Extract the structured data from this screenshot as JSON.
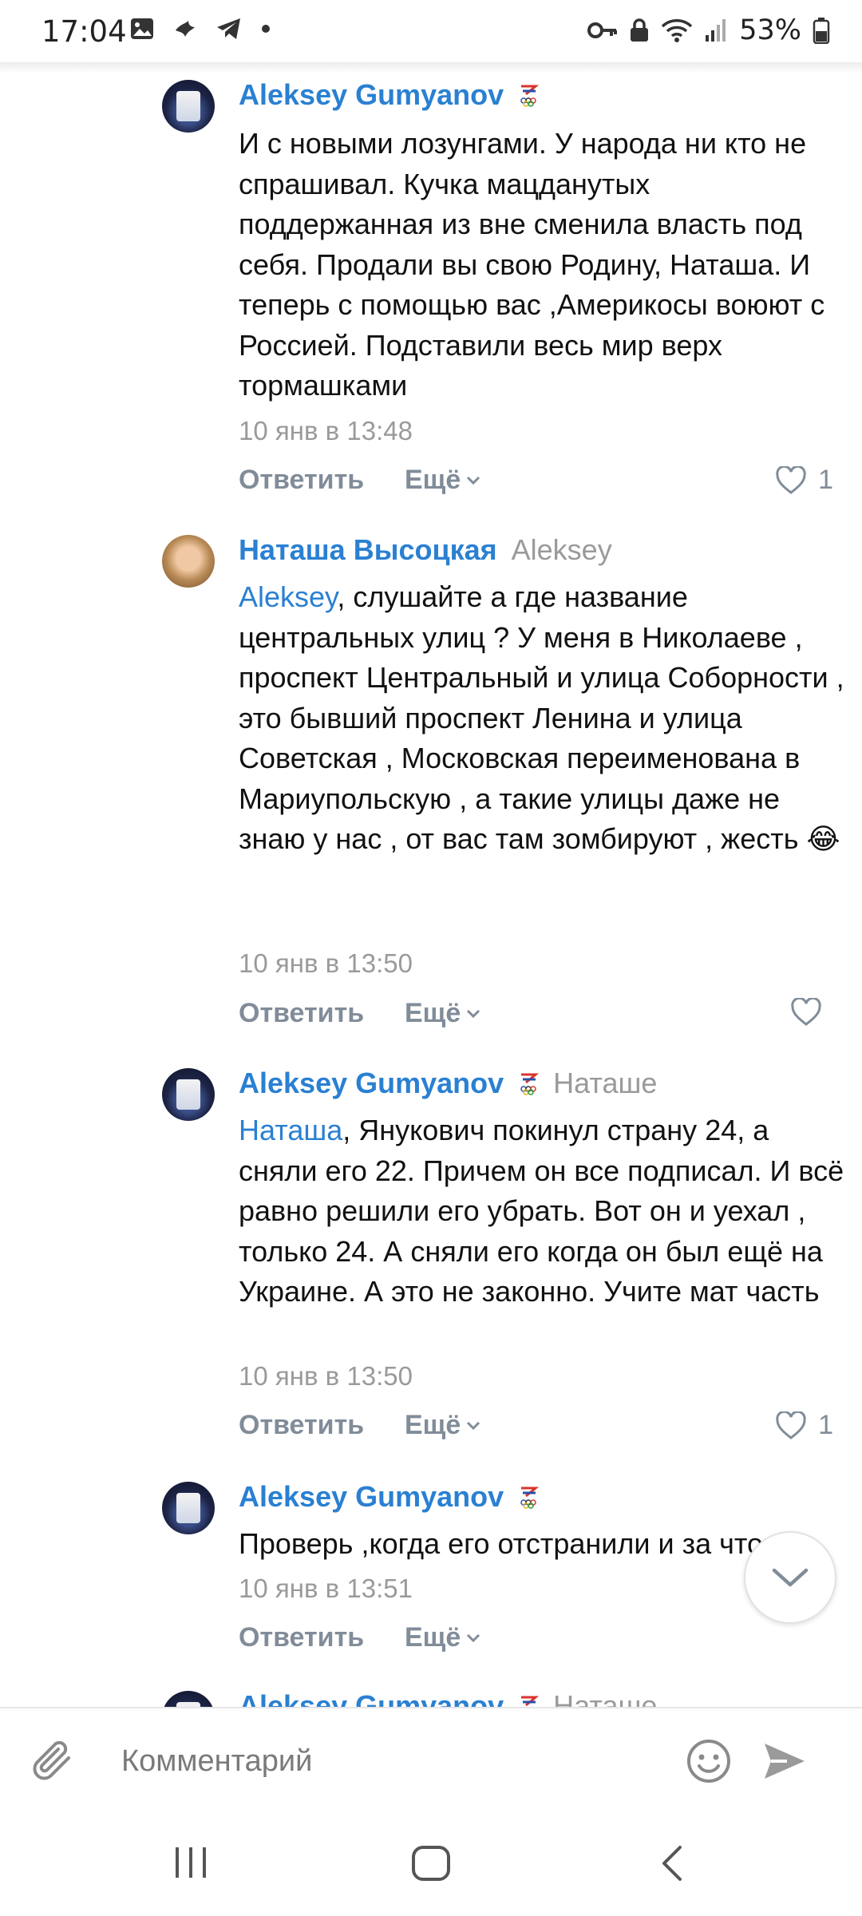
{
  "status_bar": {
    "time": "17:04",
    "battery_percent": "53%",
    "icons": [
      "gallery-icon",
      "vk-bird-icon",
      "telegram-icon",
      "dot-icon",
      "key-icon",
      "lock-icon",
      "wifi-icon",
      "signal-icon",
      "battery-icon"
    ]
  },
  "comments": [
    {
      "author": "Aleksey Gumyanov",
      "reply_to": "",
      "mention": "",
      "text": "И с новыми лозунгами. У народа ни кто не спрашивал. Кучка мацданутых поддержанная из вне сменила власть под себя. Продали вы свою Родину, Наташа. И теперь с помощью вас ,Америкосы воюют с Россией. Подставили весь мир верх тормашками",
      "date": "10 янв в 13:48",
      "reply_label": "Ответить",
      "more_label": "Ещё",
      "likes": "1"
    },
    {
      "author": "Наташа Высоцкая",
      "reply_to": "Aleksey",
      "mention": "Aleksey",
      "text": ", слушайте а где название центральных улиц ? У меня в Николаеве , проспект Центральный и улица Соборности , это бывший проспект Ленина и улица Советская , Московская переименована в Мариупольскую , а такие улицы даже не знаю у нас , от вас там зомбируют , жесть 😂",
      "date": "10 янв в 13:50",
      "reply_label": "Ответить",
      "more_label": "Ещё",
      "likes": ""
    },
    {
      "author": "Aleksey Gumyanov",
      "reply_to": "Наташе",
      "mention": "Наташа",
      "text": ", Янукович покинул страну 24, а сняли его 22. Причем он все подписал. И всё равно решили его убрать. Вот он и уехал , только 24. А сняли его когда он был ещё на Украине. А это не законно. Учите мат часть",
      "date": "10 янв в 13:50",
      "reply_label": "Ответить",
      "more_label": "Ещё",
      "likes": "1"
    },
    {
      "author": "Aleksey Gumyanov",
      "reply_to": "",
      "mention": "",
      "text": "Проверь ,когда его отстранили и за что",
      "date": "10 янв в 13:51",
      "reply_label": "Ответить",
      "more_label": "Ещё",
      "likes": ""
    },
    {
      "author": "Aleksey Gumyanov",
      "reply_to": "Наташе",
      "mention": "",
      "text": "",
      "date": "",
      "reply_label": "",
      "more_label": "",
      "likes": ""
    }
  ],
  "composer": {
    "placeholder": "Комментарий",
    "value": ""
  },
  "colors": {
    "accent": "#2a80d2",
    "secondary_text": "#818c99",
    "muted": "#9a9a9a"
  }
}
